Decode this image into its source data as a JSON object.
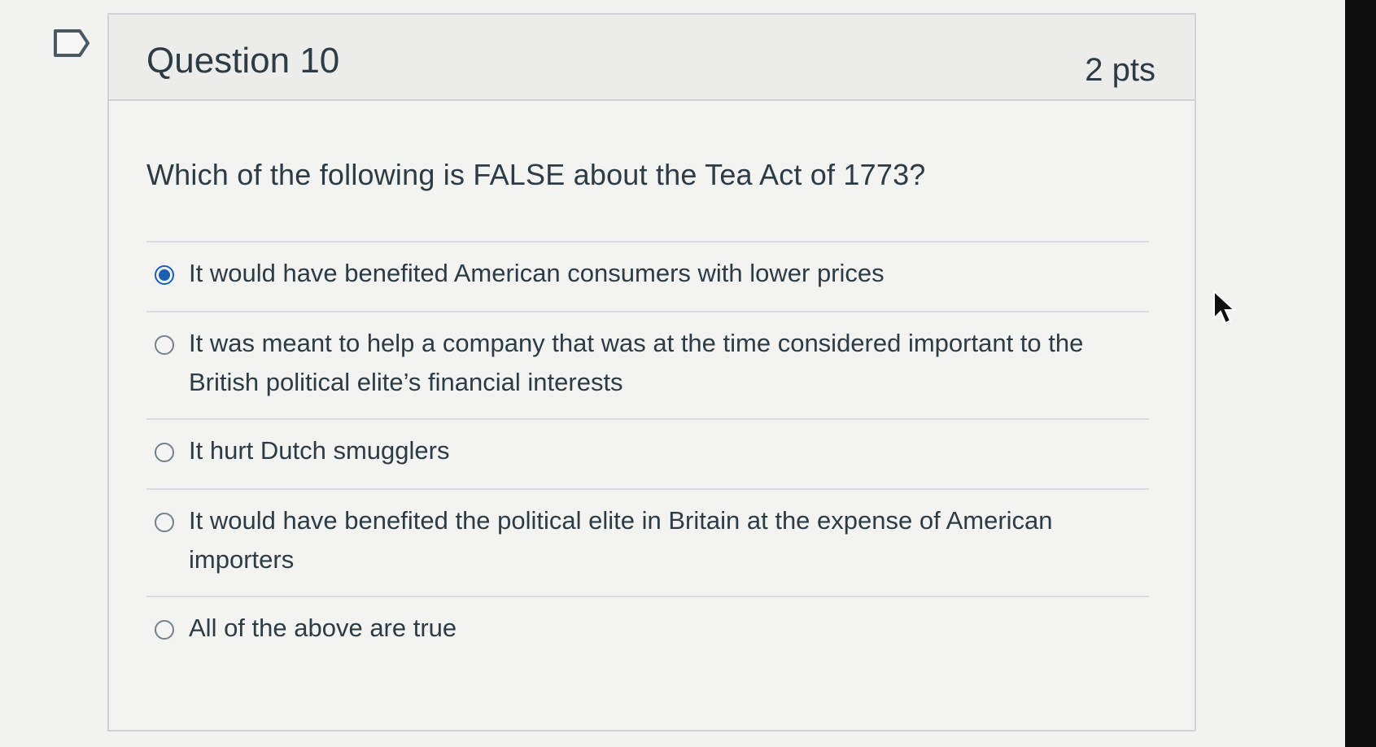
{
  "question": {
    "title": "Question 10",
    "points": "2 pts",
    "text": "Which of the following is FALSE about the Tea Act of 1773?",
    "answers": [
      {
        "label": "It would have benefited American consumers with lower prices",
        "selected": true
      },
      {
        "label": "It was meant to help a company that was at the time considered important to the British political elite’s financial interests",
        "selected": false
      },
      {
        "label": "It hurt Dutch smugglers",
        "selected": false
      },
      {
        "label": "It would have benefited the political elite in Britain at the expense of American importers",
        "selected": false
      },
      {
        "label": "All of the above are true",
        "selected": false
      }
    ]
  },
  "icons": {
    "flag": "flag-outline-icon",
    "cursor": "mouse-pointer-icon"
  },
  "colors": {
    "text": "#2d3b45",
    "accent": "#1a5fb4",
    "border": "#cfd3d6"
  }
}
